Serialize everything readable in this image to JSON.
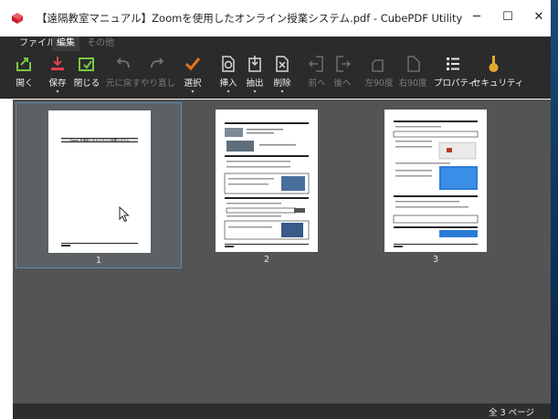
{
  "window": {
    "title": "【遠隔教室マニュアル】Zoomを使用したオンライン授業システム.pdf - CubePDF Utility",
    "minimize": "─",
    "maximize": "☐",
    "close": "✕"
  },
  "menubar": {
    "file": "ファイル",
    "edit": "編集",
    "other": "その他"
  },
  "ribbon": {
    "open": "開く",
    "save": "保存",
    "close": "閉じる",
    "undo": "元に戻す",
    "redo": "やり直し",
    "select": "選択",
    "insert": "挿入",
    "extract": "抽出",
    "delete": "削除",
    "move_prev": "前へ",
    "move_next": "後へ",
    "rotate_left": "左90度",
    "rotate_right": "右90度",
    "properties": "プロパティ",
    "security": "セキュリティ",
    "dropdown": "▾"
  },
  "pages": [
    {
      "number": "1",
      "heading": "Zoom を使用したオンライン授業システム"
    },
    {
      "number": "2"
    },
    {
      "number": "3"
    }
  ],
  "status": {
    "total_pages": "全 3 ページ"
  },
  "colors": {
    "accent": "#3c9bd6",
    "check": "#e8731a",
    "save_red": "#e0414f",
    "open_green": "#7ac943",
    "security_gold": "#e0a830"
  }
}
